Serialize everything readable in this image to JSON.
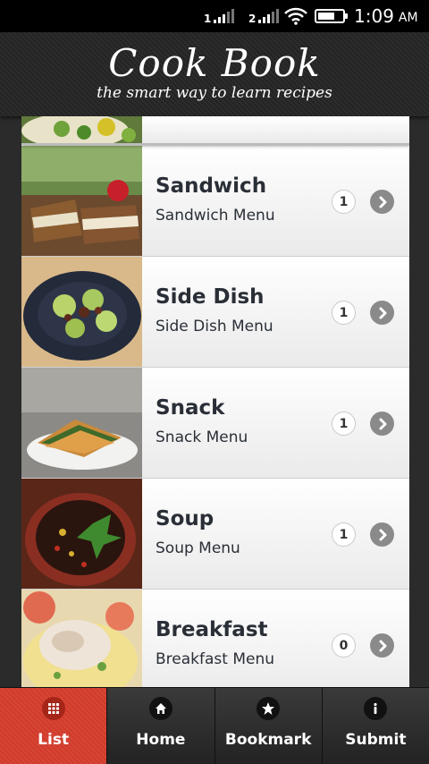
{
  "status_bar": {
    "sim1_label": "1",
    "sim2_label": "2",
    "time": "1:09",
    "ampm": "AM",
    "battery_level": 0.7,
    "icons": [
      "signal-icon",
      "signal-icon",
      "wifi-icon",
      "battery-icon"
    ]
  },
  "header": {
    "title": "Cook Book",
    "tagline": "the smart way to learn recipes"
  },
  "list": {
    "items": [
      {
        "title": "Sandwich",
        "subtitle": "Sandwich Menu",
        "count": "1"
      },
      {
        "title": "Side Dish",
        "subtitle": "Side Dish Menu",
        "count": "1"
      },
      {
        "title": "Snack",
        "subtitle": "Snack Menu",
        "count": "1"
      },
      {
        "title": "Soup",
        "subtitle": "Soup Menu",
        "count": "1"
      },
      {
        "title": "Breakfast",
        "subtitle": "Breakfast Menu",
        "count": "0"
      }
    ]
  },
  "tabbar": {
    "tabs": [
      {
        "label": "List",
        "icon": "grid-icon",
        "active": true
      },
      {
        "label": "Home",
        "icon": "home-icon",
        "active": false
      },
      {
        "label": "Bookmark",
        "icon": "star-icon",
        "active": false
      },
      {
        "label": "Submit",
        "icon": "info-icon",
        "active": false
      }
    ]
  },
  "colors": {
    "active_tab": "#d23a2a",
    "header_bg": "#242424",
    "text_dark": "#2a2f37"
  }
}
